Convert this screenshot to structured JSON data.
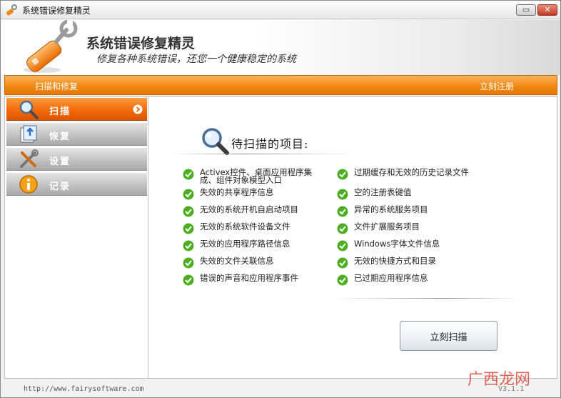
{
  "window": {
    "title": "系统错误修复精灵",
    "minimize_glyph": "▭",
    "close_glyph": "✕"
  },
  "header": {
    "app_name": "系统错误修复精灵",
    "slogan": "修复各种系统错误，还您一个健康稳定的系统"
  },
  "toolbar": {
    "scan_tab": "扫描和修复",
    "register": "立刻注册"
  },
  "sidebar": {
    "items": [
      {
        "label": "扫描",
        "icon": "magnifier-icon",
        "active": true
      },
      {
        "label": "恢复",
        "icon": "restore-icon",
        "active": false
      },
      {
        "label": "设置",
        "icon": "tools-icon",
        "active": false
      },
      {
        "label": "记录",
        "icon": "info-icon",
        "active": false
      }
    ]
  },
  "main": {
    "heading": "待扫描的项目:",
    "left_items": [
      "Activex控件、桌面应用程序集成、组件对象模型入口",
      "失效的共享程序信息",
      "无效的系统开机自启动项目",
      "无效的系统软件设备文件",
      "无效的应用程序路径信息",
      "失效的文件关联信息",
      "错误的声音和应用程序事件"
    ],
    "right_items": [
      "过期缓存和无效的历史记录文件",
      "空的注册表键值",
      "异常的系统服务项目",
      "文件扩展服务项目",
      "Windows字体文件信息",
      "无效的快捷方式和目录",
      "已过期应用程序信息"
    ],
    "scan_button": "立刻扫描"
  },
  "footer": {
    "url": "http://www.fairysoftware.com",
    "version": "V3.1.1"
  },
  "watermark": "广西龙网",
  "colors": {
    "accent_orange": "#f08a16",
    "nav_active": "#f26a0a",
    "check_green": "#4caf20"
  }
}
